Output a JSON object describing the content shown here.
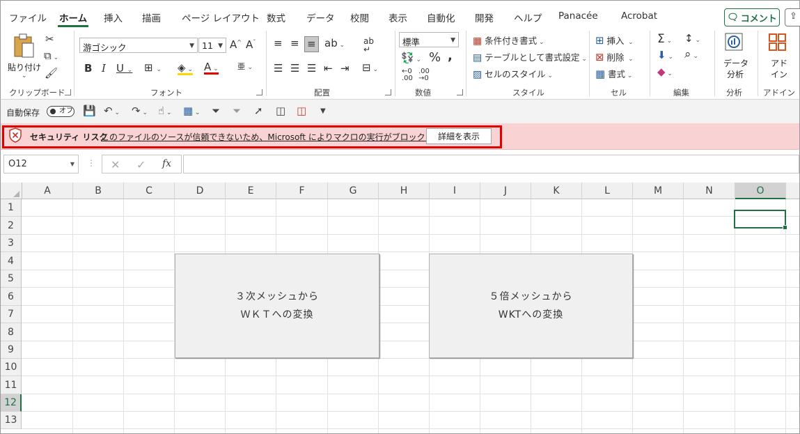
{
  "tabs": [
    {
      "label": "ファイル",
      "active": false
    },
    {
      "label": "ホーム",
      "active": true
    },
    {
      "label": "挿入",
      "active": false
    },
    {
      "label": "描画",
      "active": false
    },
    {
      "label": "ページ レイアウト",
      "active": false
    },
    {
      "label": "数式",
      "active": false
    },
    {
      "label": "データ",
      "active": false
    },
    {
      "label": "校閲",
      "active": false
    },
    {
      "label": "表示",
      "active": false
    },
    {
      "label": "自動化",
      "active": false
    },
    {
      "label": "開発",
      "active": false
    },
    {
      "label": "ヘルプ",
      "active": false
    },
    {
      "label": "Panacée",
      "active": false
    },
    {
      "label": "Acrobat",
      "active": false
    }
  ],
  "comment_button": "コメント",
  "ribbon": {
    "clipboard": {
      "paste": "貼り付け",
      "label": "クリップボード"
    },
    "font": {
      "name": "游ゴシック",
      "size": "11",
      "label": "フォント"
    },
    "alignment": {
      "label": "配置"
    },
    "number": {
      "format": "標準",
      "label": "数値"
    },
    "styles": {
      "conditional": "条件付き書式",
      "table": "テーブルとして書式設定",
      "cell_styles": "セルのスタイル",
      "label": "スタイル"
    },
    "cells": {
      "insert": "挿入",
      "delete": "削除",
      "format": "書式",
      "label": "セル"
    },
    "editing": {
      "label": "編集"
    },
    "analysis": {
      "line1": "データ",
      "line2": "分析",
      "label": "分析"
    },
    "addins": {
      "line1": "アド",
      "line2": "イン",
      "label": "アドイン"
    }
  },
  "qat": {
    "autosave": "自動保存",
    "toggle": "オフ"
  },
  "security": {
    "title": "セキュリティ リスク",
    "message": "このファイルのソースが信頼できないため、Microsoft によりマクロの実行がブロックされました。",
    "button": "詳細を表示"
  },
  "formula_bar": {
    "name_box": "O12",
    "fx": "fx",
    "formula": ""
  },
  "grid": {
    "columns": [
      "A",
      "B",
      "C",
      "D",
      "E",
      "F",
      "G",
      "H",
      "I",
      "J",
      "K",
      "L",
      "M",
      "N",
      "O"
    ],
    "rows": [
      "1",
      "2",
      "3",
      "4",
      "5",
      "6",
      "7",
      "8",
      "9",
      "10",
      "11",
      "12",
      "13"
    ],
    "selected_column": "O",
    "selected_row": "12"
  },
  "shapes": [
    {
      "line1": "３次メッシュから",
      "line2": "ＷＫＴへの変換"
    },
    {
      "line1": "５倍メッシュから",
      "line2": "WKTへの変換"
    }
  ],
  "colors": {
    "accent": "#1e7145",
    "security_bg": "#f9d3d3",
    "highlight_frame": "#e00000"
  }
}
